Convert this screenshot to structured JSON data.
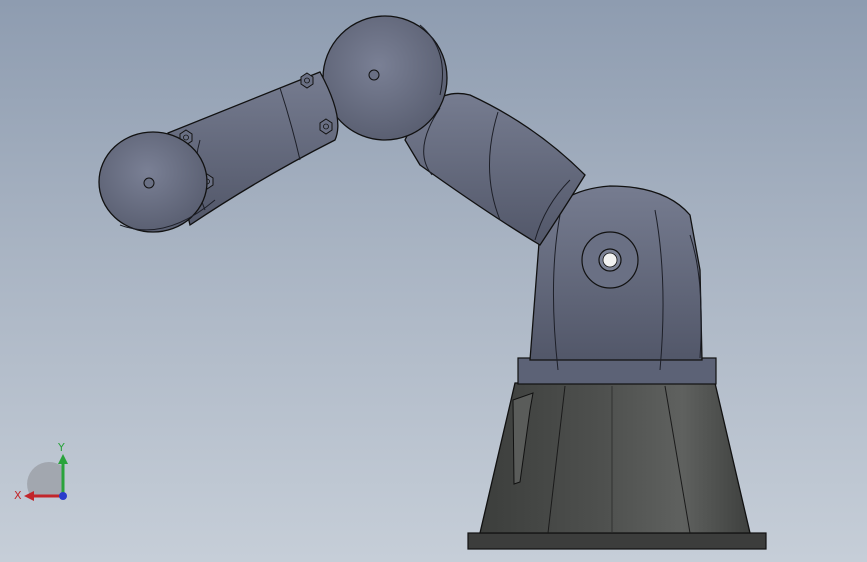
{
  "viewport": {
    "background_top": "#8e9cb0",
    "background_bottom": "#c6ced8",
    "model": "robot-arm",
    "colors": {
      "arm_body": "#5e6478",
      "arm_edge": "#1c1e26",
      "base_pedestal": "#4a4c4a"
    }
  },
  "triad": {
    "x_label": "X",
    "y_label": "Y",
    "x_color": "#c2262b",
    "y_color": "#2aa33c",
    "z_color": "#2a3ccb"
  }
}
